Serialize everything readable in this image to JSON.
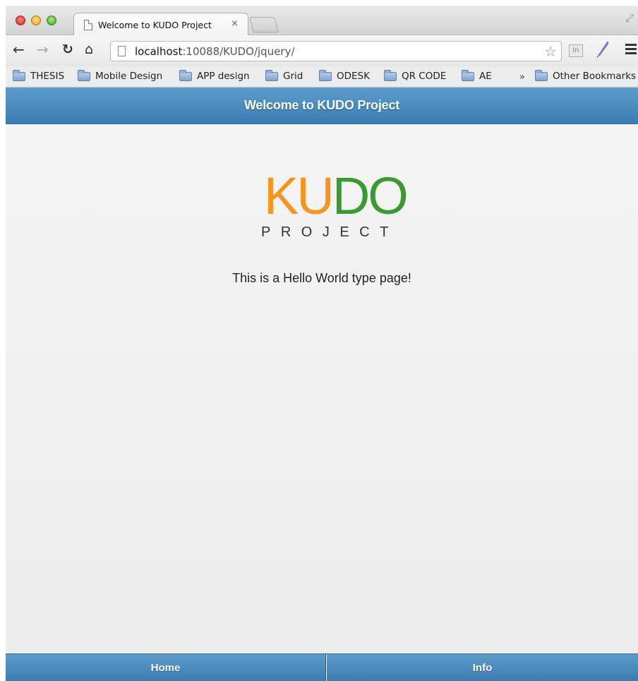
{
  "browser": {
    "tab_title": "Welcome to KUDO Project",
    "tab_close": "×",
    "url_host": "localhost",
    "url_rest": ":10088/KUDO/jquery/",
    "ext_label": "In",
    "bookmarks": [
      "THESIS",
      "Mobile Design",
      "APP design",
      "Grid",
      "ODESK",
      "QR CODE",
      "AE"
    ],
    "more_bookmarks": "»",
    "other_bookmarks": "Other Bookmarks"
  },
  "header": {
    "title": "Welcome to KUDO Project"
  },
  "logo": {
    "part1": "KU",
    "part2": "DO",
    "subtitle": "PROJECT"
  },
  "content": {
    "message": "This is a Hello World type page!"
  },
  "footer": {
    "items": [
      "Home",
      "Info"
    ]
  },
  "colors": {
    "accent": "#4a8bc2",
    "logo_orange": "#f7941d",
    "logo_green": "#3a9a2f"
  }
}
